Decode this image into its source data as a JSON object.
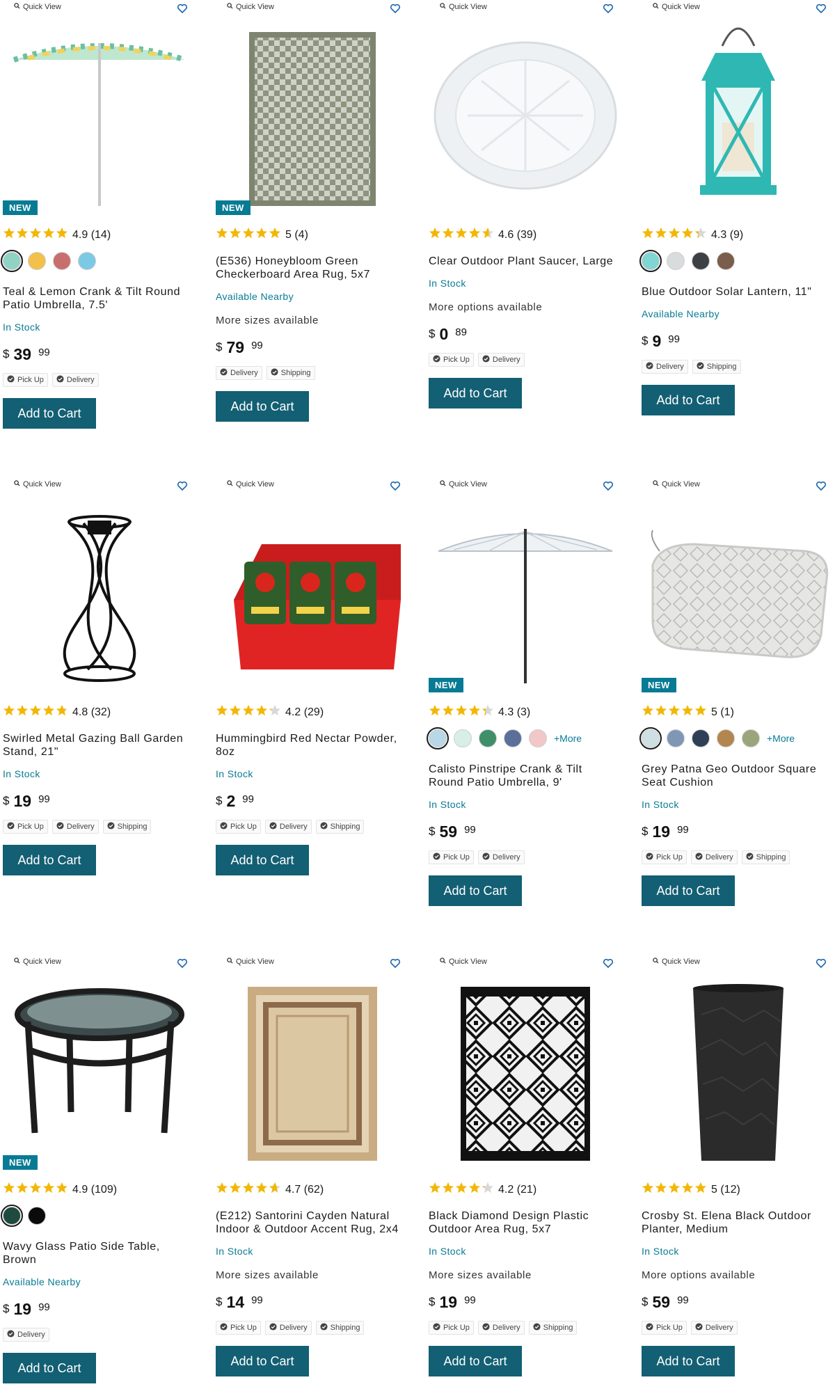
{
  "quick_view_label": "Quick View",
  "add_to_cart_label": "Add to Cart",
  "currency": "$",
  "colors": {
    "accent": "#087b94",
    "button": "#135f73",
    "star": "#f2b705"
  },
  "products": [
    {
      "badge": "NEW",
      "stars": 5,
      "rating": "4.9 (14)",
      "swatches": [
        "#8fd3c4",
        "#f3c04b",
        "#c96e6e",
        "#7cc9e6"
      ],
      "more": "",
      "title_lines": [
        "Teal & Lemon Crank & Tilt Round",
        "Patio Umbrella, 7.5'"
      ],
      "availability": "In Stock",
      "note": "",
      "price_dollars": "39",
      "price_cents": "99",
      "fulfillment": [
        "Pick Up",
        "Delivery"
      ],
      "image": "umbrella-teal-lemon"
    },
    {
      "badge": "NEW",
      "stars": 5,
      "rating": "5 (4)",
      "swatches": [],
      "more": "",
      "title_lines": [
        "(E536) Honeybloom Green",
        "Checkerboard Area Rug, 5x7"
      ],
      "availability": "Available Nearby",
      "note": "More sizes available",
      "price_dollars": "79",
      "price_cents": "99",
      "fulfillment": [
        "Delivery",
        "Shipping"
      ],
      "image": "rug-checkerboard"
    },
    {
      "badge": "",
      "stars": 4.6,
      "rating": "4.6 (39)",
      "swatches": [],
      "more": "",
      "title_lines": [
        "Clear Outdoor Plant Saucer, Large"
      ],
      "availability": "In Stock",
      "note": "More options available",
      "price_dollars": "0",
      "price_cents": "89",
      "fulfillment": [
        "Pick Up",
        "Delivery"
      ],
      "image": "plant-saucer"
    },
    {
      "badge": "",
      "stars": 4.3,
      "rating": "4.3 (9)",
      "swatches": [
        "#7fd6d3",
        "#d9dcdc",
        "#3d4145",
        "#7a5d4a"
      ],
      "more": "",
      "title_lines": [
        "Blue Outdoor Solar Lantern, 11\""
      ],
      "availability": "Available Nearby",
      "note": "",
      "price_dollars": "9",
      "price_cents": "99",
      "fulfillment": [
        "Delivery",
        "Shipping"
      ],
      "image": "solar-lantern"
    },
    {
      "badge": "",
      "stars": 4.8,
      "rating": "4.8 (32)",
      "swatches": [],
      "more": "",
      "title_lines": [
        "Swirled Metal Gazing Ball Garden",
        "Stand, 21\""
      ],
      "availability": "In Stock",
      "note": "",
      "price_dollars": "19",
      "price_cents": "99",
      "fulfillment": [
        "Pick Up",
        "Delivery",
        "Shipping"
      ],
      "image": "gazing-ball-stand"
    },
    {
      "badge": "",
      "stars": 4.2,
      "rating": "4.2 (29)",
      "swatches": [],
      "more": "",
      "title_lines": [
        "Hummingbird Red Nectar Powder,",
        "8oz"
      ],
      "availability": "In Stock",
      "note": "",
      "price_dollars": "2",
      "price_cents": "99",
      "fulfillment": [
        "Pick Up",
        "Delivery",
        "Shipping"
      ],
      "image": "nectar-display"
    },
    {
      "badge": "NEW",
      "stars": 4.3,
      "rating": "4.3 (3)",
      "swatches": [
        "#b8d8e8",
        "#d8eee6",
        "#3f8f6a",
        "#5a6f9a",
        "#f2c7c7"
      ],
      "more": "+More",
      "title_lines": [
        "Calisto Pinstripe Crank & Tilt",
        "Round Patio Umbrella, 9'"
      ],
      "availability": "In Stock",
      "note": "",
      "price_dollars": "59",
      "price_cents": "99",
      "fulfillment": [
        "Pick Up",
        "Delivery"
      ],
      "image": "umbrella-pinstripe"
    },
    {
      "badge": "NEW",
      "stars": 5,
      "rating": "5 (1)",
      "swatches": [
        "#cfe0e4",
        "#7f97b5",
        "#2f3f55",
        "#b3864f",
        "#9aa57c"
      ],
      "more": "+More",
      "title_lines": [
        "Grey Patna Geo Outdoor Square",
        "Seat Cushion"
      ],
      "availability": "In Stock",
      "note": "",
      "price_dollars": "19",
      "price_cents": "99",
      "fulfillment": [
        "Pick Up",
        "Delivery",
        "Shipping"
      ],
      "image": "seat-cushion"
    },
    {
      "badge": "NEW",
      "stars": 4.9,
      "rating": "4.9 (109)",
      "swatches": [
        "#1f4a40",
        "#0b0b0b"
      ],
      "more": "",
      "title_lines": [
        "Wavy Glass Patio Side Table,",
        "Brown"
      ],
      "availability": "Available Nearby",
      "note": "",
      "price_dollars": "19",
      "price_cents": "99",
      "fulfillment": [
        "Delivery"
      ],
      "image": "side-table"
    },
    {
      "badge": "",
      "stars": 4.7,
      "rating": "4.7 (62)",
      "swatches": [],
      "more": "",
      "title_lines": [
        "(E212) Santorini Cayden Natural",
        "Indoor & Outdoor Accent Rug, 2x4"
      ],
      "availability": "In Stock",
      "note": "More sizes available",
      "price_dollars": "14",
      "price_cents": "99",
      "fulfillment": [
        "Pick Up",
        "Delivery",
        "Shipping"
      ],
      "image": "rug-natural"
    },
    {
      "badge": "",
      "stars": 4.2,
      "rating": "4.2 (21)",
      "swatches": [],
      "more": "",
      "title_lines": [
        "Black Diamond Design Plastic",
        "Outdoor Area Rug, 5x7"
      ],
      "availability": "In Stock",
      "note": "More sizes available",
      "price_dollars": "19",
      "price_cents": "99",
      "fulfillment": [
        "Pick Up",
        "Delivery",
        "Shipping"
      ],
      "image": "rug-diamond"
    },
    {
      "badge": "",
      "stars": 5,
      "rating": "5 (12)",
      "swatches": [],
      "more": "",
      "title_lines": [
        "Crosby St. Elena Black Outdoor",
        "Planter, Medium"
      ],
      "availability": "In Stock",
      "note": "More options available",
      "price_dollars": "59",
      "price_cents": "99",
      "fulfillment": [
        "Pick Up",
        "Delivery"
      ],
      "image": "planter-black"
    }
  ]
}
